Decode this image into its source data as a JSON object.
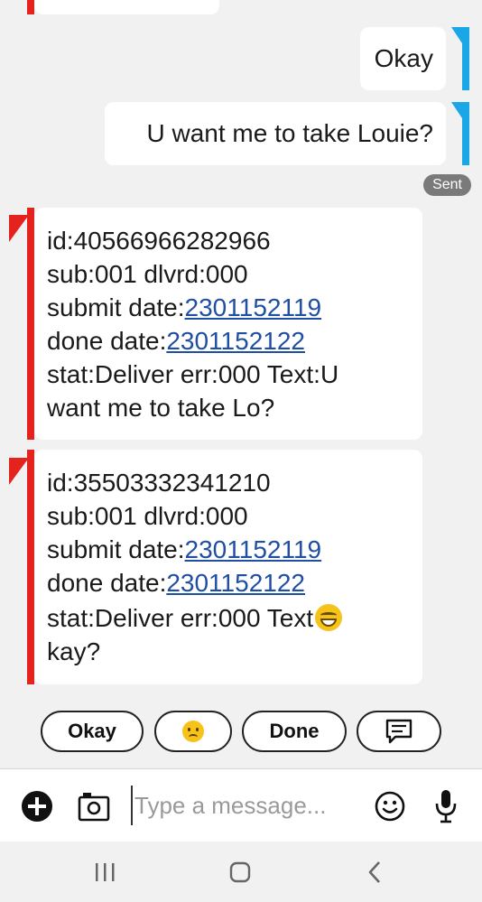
{
  "messages": {
    "outgoing": [
      {
        "text": "Okay"
      },
      {
        "text": "U want me to take Louie?"
      }
    ],
    "sent_label": "Sent",
    "incoming": [
      {
        "id_line": "id:40566966282966",
        "sub_line": "sub:001 dlvrd:000",
        "submit_prefix": "submit date:",
        "submit_value": "2301152119",
        "done_prefix": "done date:",
        "done_value": "2301152122",
        "stat_line": "stat:Deliver err:000 Text:U",
        "last_line": "want me to take Lo?"
      },
      {
        "id_line": "id:35503332341210",
        "sub_line": "sub:001 dlvrd:000",
        "submit_prefix": "submit date:",
        "submit_value": "2301152119",
        "done_prefix": "done date:",
        "done_value": "2301152122",
        "stat_line": "stat:Deliver err:000 Text",
        "stat_emoji": "grinning-squinting-emoji",
        "last_line": "kay?"
      }
    ]
  },
  "smart_replies": {
    "okay_label": "Okay",
    "emoji_name": "worried-face-emoji",
    "done_label": "Done",
    "compose_icon": "message-compose-icon"
  },
  "composer": {
    "placeholder": "Type a message...",
    "icons": [
      "add-icon",
      "camera-icon",
      "emoji-icon",
      "microphone-icon"
    ]
  },
  "navbar": {
    "icons": [
      "recent-apps-icon",
      "home-icon",
      "back-icon"
    ]
  },
  "colors": {
    "incoming_accent": "#e4231f",
    "outgoing_accent": "#1aa7e8",
    "link": "#1f4ea3",
    "background": "#f1f1f1"
  }
}
